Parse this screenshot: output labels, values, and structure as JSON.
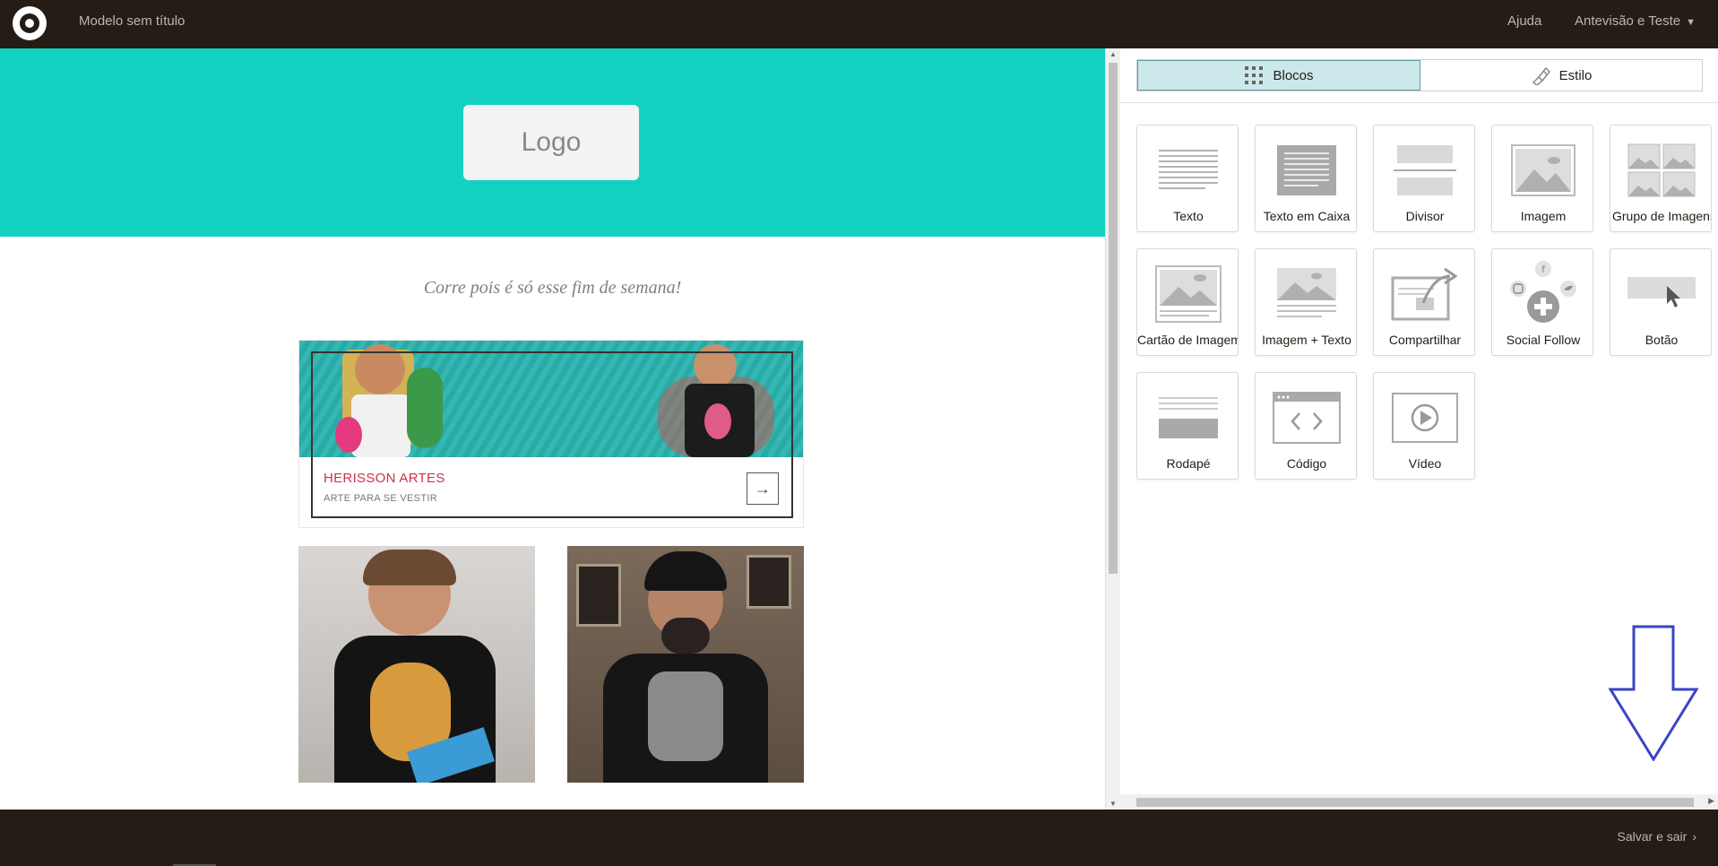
{
  "app": {
    "title": "Modelo sem título",
    "help": "Ajuda",
    "preview": "Antevisão e Teste"
  },
  "canvas": {
    "logo_placeholder": "Logo",
    "tagline": "Corre pois é só esse fim de semana!",
    "card": {
      "title": "HERISSON ARTES",
      "subtitle": "ARTE PARA SE VESTIR",
      "arrow": "→"
    },
    "colors": {
      "hero": "#14d2c1",
      "card_title": "#d0304a"
    }
  },
  "panel": {
    "tabs": [
      {
        "label": "Blocos",
        "icon": "grid-icon",
        "active": true
      },
      {
        "label": "Estilo",
        "icon": "paintbrush-icon",
        "active": false
      }
    ],
    "blocks": [
      {
        "label": "Texto",
        "icon": "text-block-icon"
      },
      {
        "label": "Texto em Caixa",
        "icon": "boxed-text-icon"
      },
      {
        "label": "Divisor",
        "icon": "divider-icon"
      },
      {
        "label": "Imagem",
        "icon": "image-icon"
      },
      {
        "label": "Grupo de Imagens",
        "icon": "image-group-icon"
      },
      {
        "label": "Cartão de Imagem",
        "icon": "image-card-icon"
      },
      {
        "label": "Imagem + Texto",
        "icon": "image-text-icon"
      },
      {
        "label": "Compartilhar",
        "icon": "share-icon"
      },
      {
        "label": "Social Follow",
        "icon": "social-follow-icon"
      },
      {
        "label": "Botão",
        "icon": "button-icon"
      },
      {
        "label": "Rodapé",
        "icon": "footer-icon"
      },
      {
        "label": "Código",
        "icon": "code-icon"
      },
      {
        "label": "Vídeo",
        "icon": "video-icon"
      }
    ]
  },
  "footer": {
    "save_exit": "Salvar e sair"
  }
}
